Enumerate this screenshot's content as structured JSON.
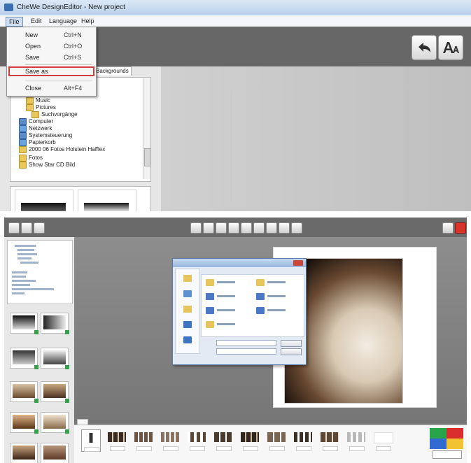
{
  "window": {
    "title": "CheWe DesignEditor - New project"
  },
  "menubar": {
    "file": "File",
    "edit": "Edit",
    "language": "Language",
    "help": "Help"
  },
  "file_menu": {
    "items": [
      {
        "label": "New",
        "shortcut": "Ctrl+N"
      },
      {
        "label": "Open",
        "shortcut": "Ctrl+O"
      },
      {
        "label": "Save",
        "shortcut": "Ctrl+S"
      },
      {
        "label": "Save as",
        "shortcut": ""
      },
      {
        "label": "Close",
        "shortcut": "Alt+F4"
      }
    ],
    "highlighted": "Save as",
    "highlight_color": "#d43d3d"
  },
  "left_panel": {
    "tab_label": "Backgrounds",
    "tree": [
      {
        "label": "Music",
        "icon": "folder-icon"
      },
      {
        "label": "Pictures",
        "icon": "folder-icon"
      },
      {
        "label": "Suchvorgänge",
        "icon": "folder-icon"
      },
      {
        "label": "Computer",
        "icon": "computer-icon"
      },
      {
        "label": "Netzwerk",
        "icon": "network-icon"
      },
      {
        "label": "Systemsteuerung",
        "icon": "control-panel-icon"
      },
      {
        "label": "Papierkorb",
        "icon": "recycle-bin-icon"
      },
      {
        "label": "2000 06 Fotos Holstein Hafflex",
        "icon": "folder-icon"
      },
      {
        "label": "Fotos",
        "icon": "folder-icon"
      },
      {
        "label": "Show Star CD Bild",
        "icon": "folder-icon"
      }
    ]
  },
  "toolbar": {
    "undo_icon": "undo-arrow-icon",
    "font_icon": "font-aa-icon"
  },
  "colors": {
    "toolbar_bg": "#676767",
    "canvas_bg": "#c8c8c8",
    "accent": "#d43d3d"
  }
}
